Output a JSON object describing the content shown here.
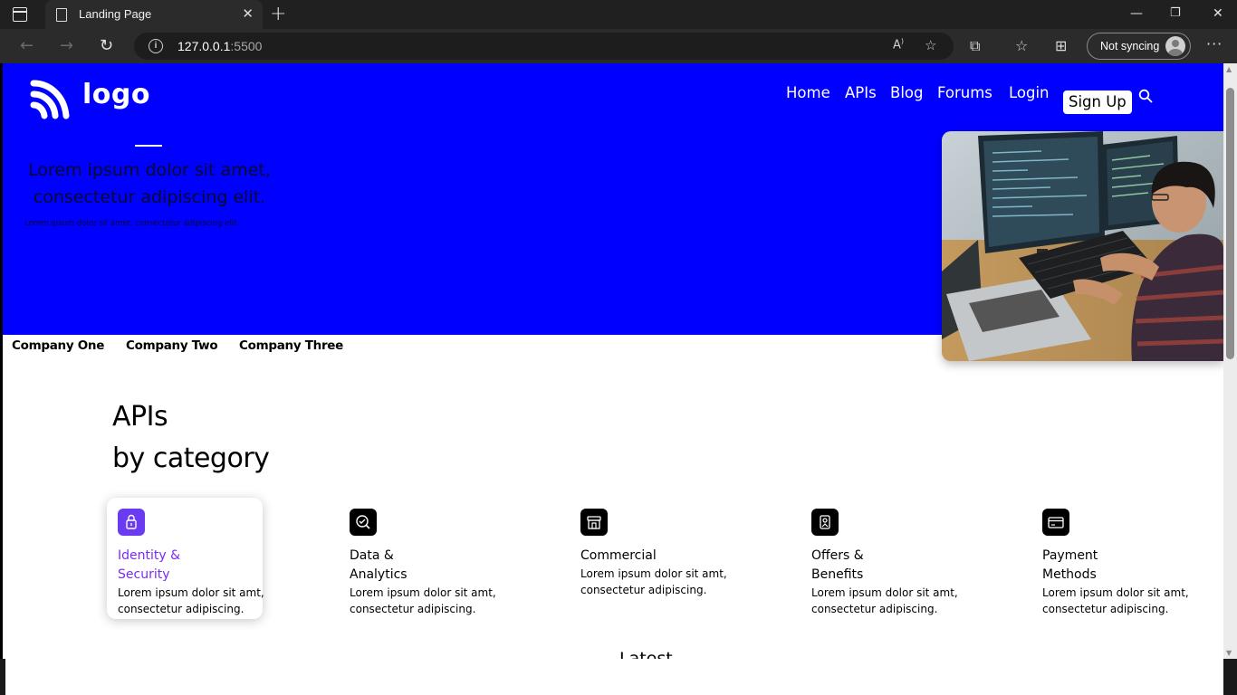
{
  "browser": {
    "tab_title": "Landing Page",
    "url_host": "127.0.0.1",
    "url_port": ":5500",
    "profile_label": "Not syncing"
  },
  "header": {
    "logo_text": "logo",
    "nav": [
      "Home",
      "APIs",
      "Blog",
      "Forums",
      "Login"
    ],
    "signup_label": "Sign Up"
  },
  "hero": {
    "title_line1": "Lorem ipsum dolor sit amet,",
    "title_line2": "consectetur adipiscing elit.",
    "subtitle": "Lorem ipsum dolor sit amet, consectetur adipiscing elit."
  },
  "companies": [
    "Company One",
    "Company Two",
    "Company Three"
  ],
  "apis": {
    "title_line1": "APIs",
    "title_line2": "by category"
  },
  "categories": [
    {
      "title_line1": "Identity &",
      "title_line2": "Security",
      "desc_line1": "Lorem ipsum dolor sit amt,",
      "desc_line2": "consectetur adipiscing.",
      "icon": "lock-icon"
    },
    {
      "title_line1": "Data &",
      "title_line2": "Analytics",
      "desc_line1": "Lorem ipsum dolor sit amt,",
      "desc_line2": "consectetur adipiscing.",
      "icon": "analytics-icon"
    },
    {
      "title_line1": "Commercial",
      "title_line2": "",
      "desc_line1": "Lorem ipsum dolor sit amt,",
      "desc_line2": "consectetur adipiscing.",
      "icon": "store-icon"
    },
    {
      "title_line1": "Offers &",
      "title_line2": "Benefits",
      "desc_line1": "Lorem ipsum dolor sit amt,",
      "desc_line2": "consectetur adipiscing.",
      "icon": "gift-icon"
    },
    {
      "title_line1": "Payment",
      "title_line2": "Methods",
      "desc_line1": "Lorem ipsum dolor sit amt,",
      "desc_line2": "consectetur adipiscing.",
      "icon": "credit-card-icon"
    }
  ],
  "latest_heading": "Latest",
  "colors": {
    "hero_bg": "#0000ff",
    "accent_purple": "#7a2bf5",
    "icon_purple": "#6b3bf2"
  }
}
